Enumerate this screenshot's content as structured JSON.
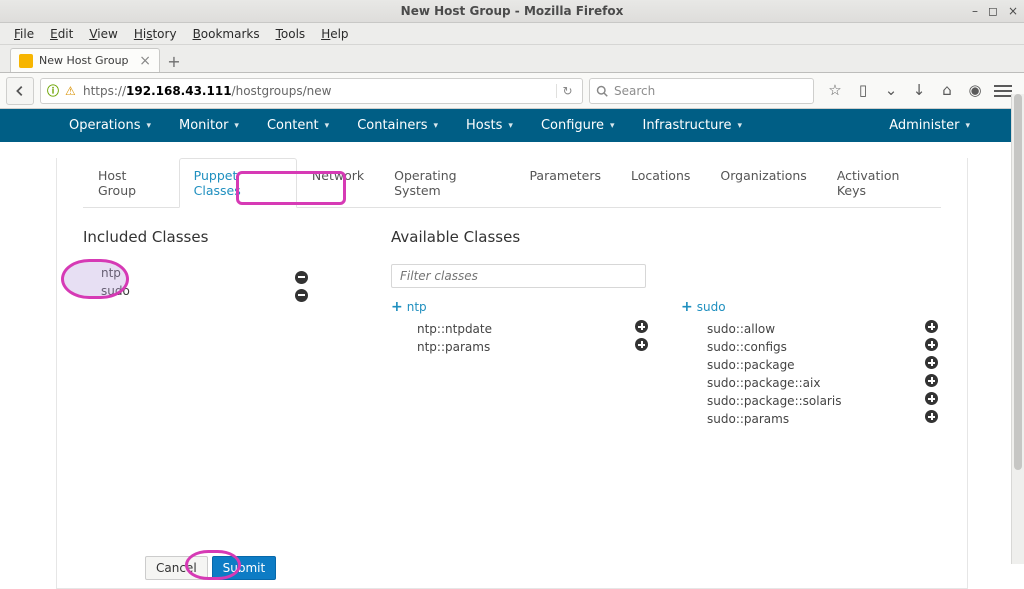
{
  "window": {
    "title": "New Host Group - Mozilla Firefox"
  },
  "menubar": [
    "File",
    "Edit",
    "View",
    "History",
    "Bookmarks",
    "Tools",
    "Help"
  ],
  "tab": {
    "title": "New Host Group"
  },
  "url": {
    "prefix_ip": "192.168.43.111",
    "path": "/hostgroups/new",
    "scheme": "https://"
  },
  "search": {
    "placeholder": "Search"
  },
  "appnav": {
    "items": [
      "Operations",
      "Monitor",
      "Content",
      "Containers",
      "Hosts",
      "Configure",
      "Infrastructure"
    ],
    "right": "Administer"
  },
  "form_tabs": [
    "Host Group",
    "Puppet Classes",
    "Network",
    "Operating System",
    "Parameters",
    "Locations",
    "Organizations",
    "Activation Keys"
  ],
  "active_tab_index": 1,
  "included": {
    "heading": "Included Classes",
    "items": [
      "ntp",
      "sudo"
    ]
  },
  "available": {
    "heading": "Available Classes",
    "filter_placeholder": "Filter classes",
    "groups": [
      {
        "name": "ntp",
        "children": [
          "ntp::ntpdate",
          "ntp::params"
        ]
      },
      {
        "name": "sudo",
        "children": [
          "sudo::allow",
          "sudo::configs",
          "sudo::package",
          "sudo::package::aix",
          "sudo::package::solaris",
          "sudo::params"
        ]
      }
    ]
  },
  "footer": {
    "cancel": "Cancel",
    "submit": "Submit"
  }
}
